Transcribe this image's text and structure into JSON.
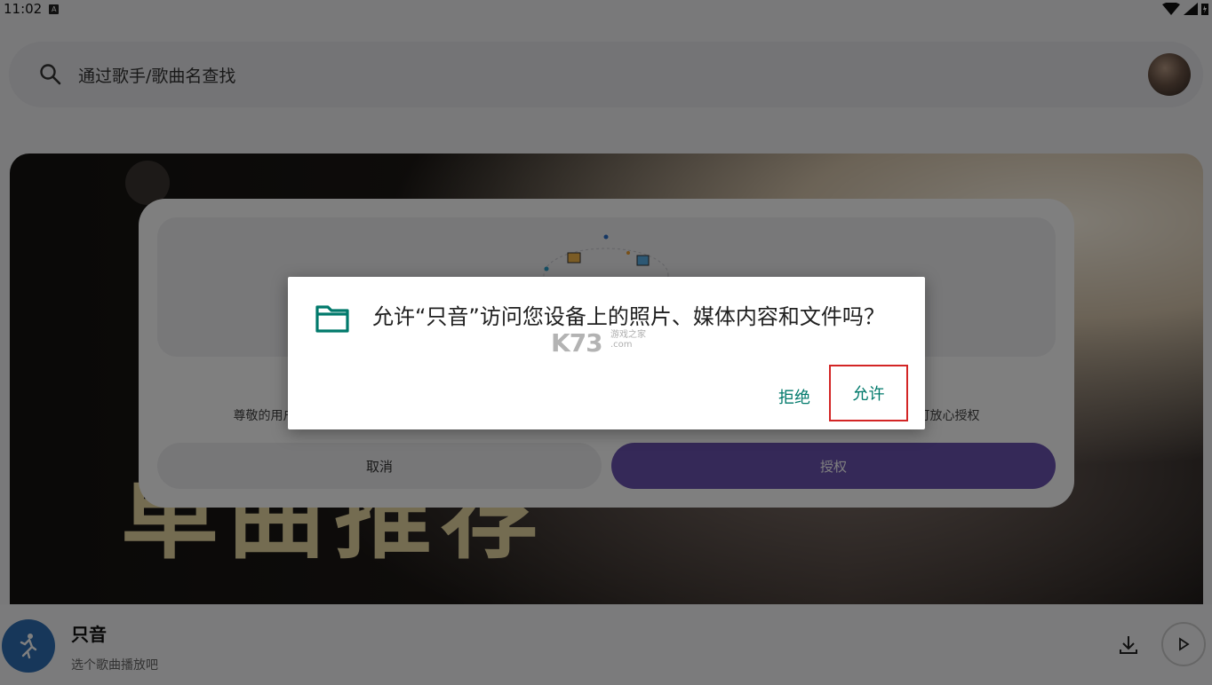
{
  "status_bar": {
    "time": "11:02",
    "notification_icon": "a-badge-icon"
  },
  "search": {
    "placeholder": "通过歌手/歌曲名查找"
  },
  "banner": {
    "title": "单曲推荐"
  },
  "app_dialog": {
    "description": "尊敬的用户，本软件需要获取您的存储权限，用于下载和保存音乐，我们不会泄露您的任何隐私信息及数据，请放心授权，您可放心授权",
    "cancel_label": "取消",
    "authorize_label": "授权"
  },
  "permission_dialog": {
    "message": "允许“只音”访问您设备上的照片、媒体内容和文件吗？",
    "deny_label": "拒绝",
    "allow_label": "允许",
    "accent_color": "#00796b",
    "highlight_color": "#d32525"
  },
  "mini_player": {
    "title": "只音",
    "subtitle": "选个歌曲播放吧"
  },
  "watermark": {
    "main": "K73",
    "sub1": "游戏之家",
    "sub2": ".com"
  }
}
